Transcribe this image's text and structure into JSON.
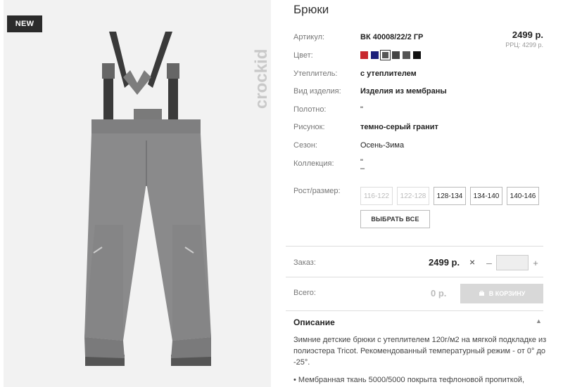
{
  "badge": "NEW",
  "brand": "crockid",
  "product": {
    "title": "Брюки",
    "sku_label": "Артикул:",
    "sku": "ВК 40008/22/2 ГР",
    "price": "2499 р.",
    "rrp": "РРЦ: 4299 р.",
    "color_label": "Цвет:",
    "colors": [
      "#c8282e",
      "#1c1f7a",
      "#555555",
      "#444444",
      "#555555",
      "#111111"
    ],
    "insulation_label": "Утеплитель:",
    "insulation": "с утеплителем",
    "type_label": "Вид изделия:",
    "type": "Изделия из мембраны",
    "fabric_label": "Полотно:",
    "fabric": "\"",
    "pattern_label": "Рисунок:",
    "pattern": "темно-серый гранит",
    "season_label": "Сезон:",
    "season": "Осень-Зима",
    "collection_label": "Коллекция:",
    "collection": "\"",
    "collection_sub": "–",
    "size_label": "Рост/размер:",
    "sizes": [
      "116-122",
      "122-128",
      "128-134",
      "134-140",
      "140-146"
    ],
    "select_all": "ВЫБРАТЬ ВСЕ"
  },
  "order": {
    "label": "Заказ:",
    "price": "2499 р.",
    "times": "×",
    "minus": "–",
    "plus": "+",
    "qty": ""
  },
  "total": {
    "label": "Всего:",
    "value": "0 р.",
    "cart_button": "В КОРЗИНУ"
  },
  "description": {
    "title": "Описание",
    "text": "Зимние детские брюки с утеплителем 120г/м2 на мягкой подкладке из полиэстера Tricot. Рекомендованный температурный режим - от 0° до -25°.",
    "text2": "• Мембранная ткань 5000/5000 покрыта тефлоновой пропиткой,"
  }
}
